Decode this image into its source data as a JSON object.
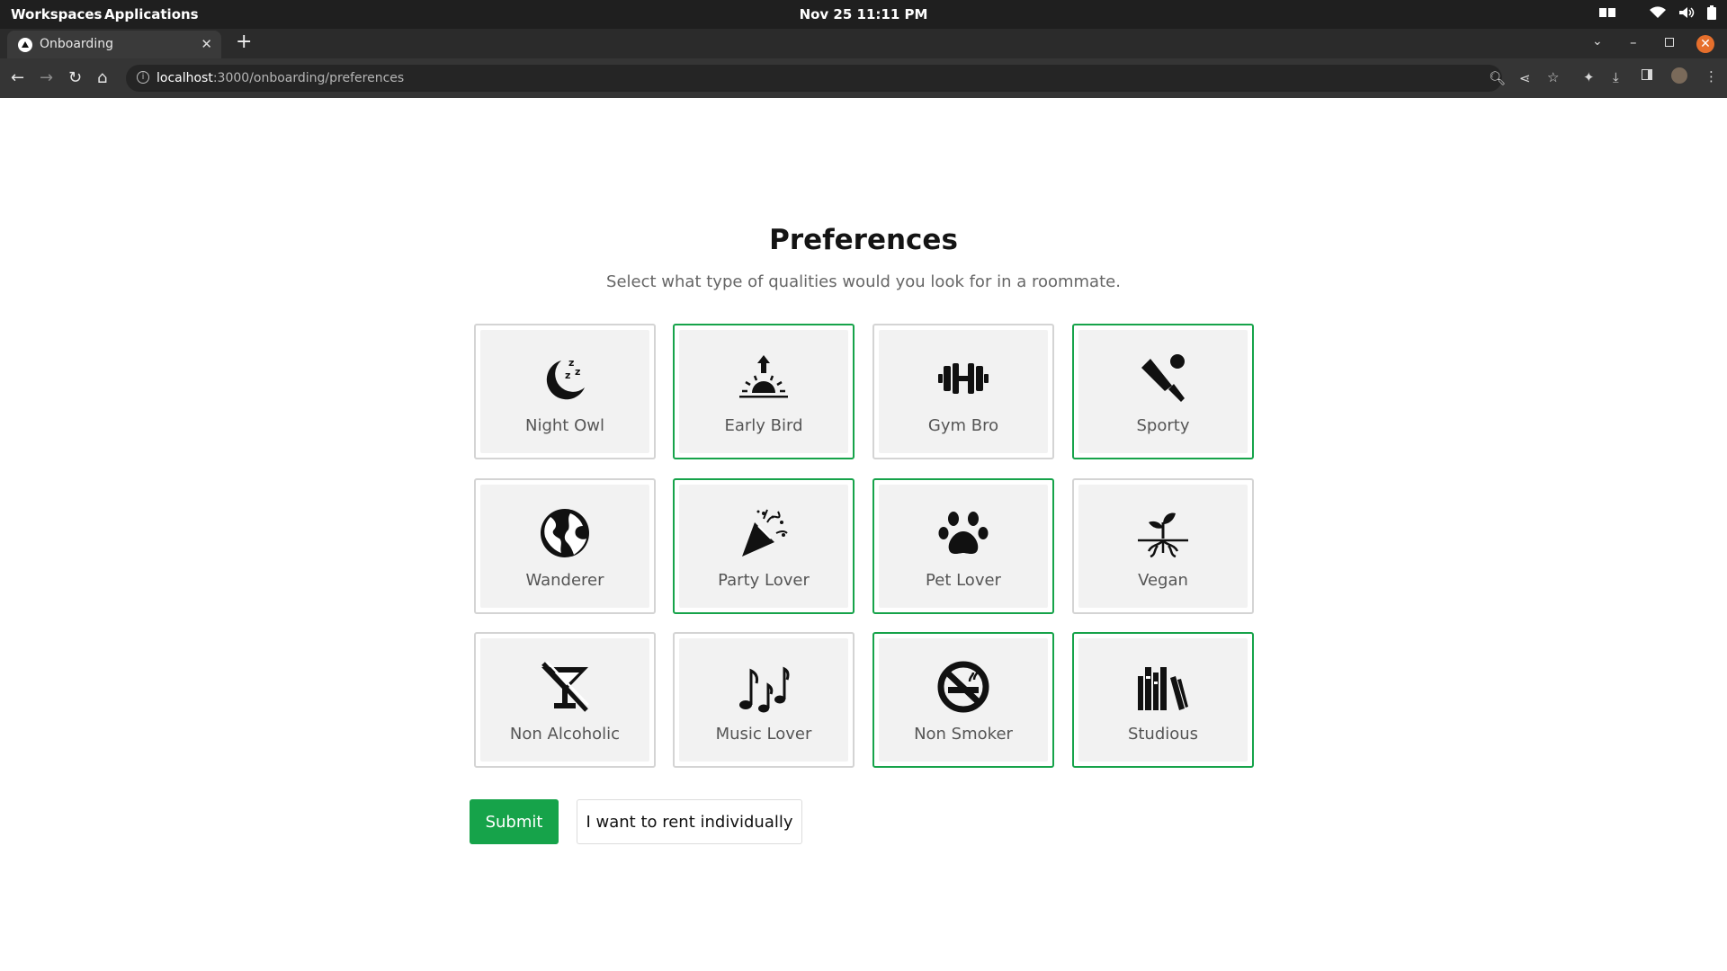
{
  "system_bar": {
    "workspaces": "Workspaces",
    "applications": "Applications",
    "clock": "Nov 25  11:11 PM"
  },
  "browser": {
    "tab_title": "Onboarding",
    "url_host": "localhost",
    "url_path": ":3000/onboarding/preferences"
  },
  "page": {
    "title": "Preferences",
    "subtitle": "Select what type of qualities would you look for in a roommate."
  },
  "options": [
    {
      "label": "Night Owl",
      "icon": "moon-sleep-icon",
      "selected": false
    },
    {
      "label": "Early Bird",
      "icon": "sunrise-icon",
      "selected": true
    },
    {
      "label": "Gym Bro",
      "icon": "dumbbell-icon",
      "selected": false
    },
    {
      "label": "Sporty",
      "icon": "cricket-bat-icon",
      "selected": true
    },
    {
      "label": "Wanderer",
      "icon": "globe-icon",
      "selected": false
    },
    {
      "label": "Party Lover",
      "icon": "party-popper-icon",
      "selected": true
    },
    {
      "label": "Pet Lover",
      "icon": "paw-icon",
      "selected": true
    },
    {
      "label": "Vegan",
      "icon": "sprout-icon",
      "selected": false
    },
    {
      "label": "Non Alcoholic",
      "icon": "no-cocktail-icon",
      "selected": false
    },
    {
      "label": "Music Lover",
      "icon": "music-notes-icon",
      "selected": false
    },
    {
      "label": "Non Smoker",
      "icon": "no-smoking-icon",
      "selected": true
    },
    {
      "label": "Studious",
      "icon": "books-icon",
      "selected": true
    }
  ],
  "actions": {
    "submit": "Submit",
    "individual": "I want to rent individually"
  },
  "colors": {
    "accent": "#16a34a",
    "card_border": "#d4d4d4",
    "card_bg": "#f2f2f2"
  }
}
